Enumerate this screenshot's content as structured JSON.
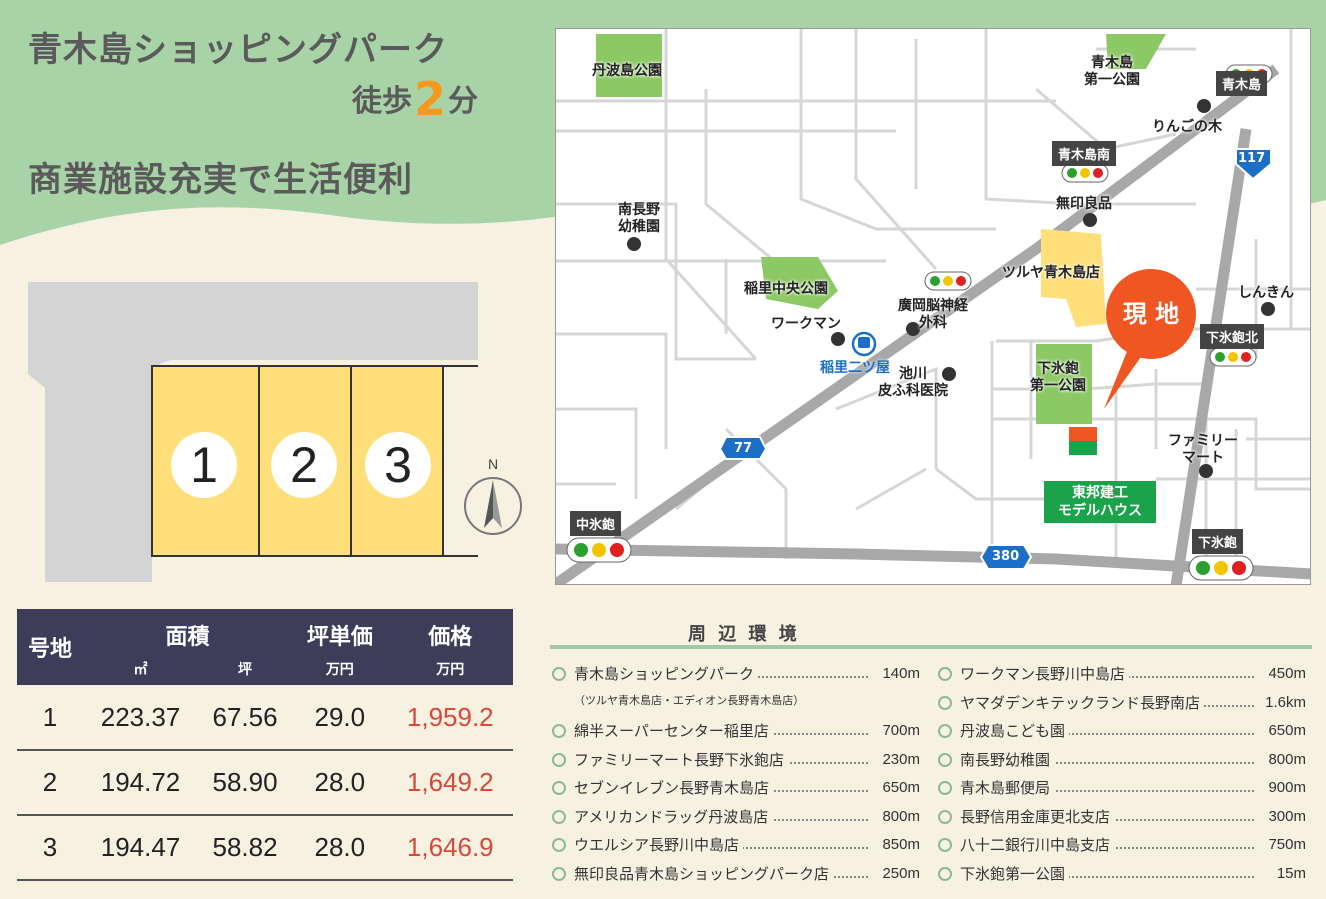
{
  "headline": "青木島ショッピングパーク",
  "walk": {
    "prefix": "徒歩",
    "number": "2",
    "suffix": "分"
  },
  "subline": "商業施設充実で生活便利",
  "lots": [
    "1",
    "2",
    "3"
  ],
  "compass": "N",
  "table": {
    "headers": {
      "lot": "号地",
      "area": "面積",
      "unit_price": "坪単価",
      "price": "価格"
    },
    "units": {
      "sqm": "㎡",
      "tsubo": "坪",
      "unit_price": "万円",
      "price": "万円"
    },
    "rows": [
      {
        "lot": "1",
        "sqm": "223.37",
        "tsubo": "67.56",
        "unit_price": "29.0",
        "price": "1,959.2"
      },
      {
        "lot": "2",
        "sqm": "194.72",
        "tsubo": "58.90",
        "unit_price": "28.0",
        "price": "1,649.2"
      },
      {
        "lot": "3",
        "sqm": "194.47",
        "tsubo": "58.82",
        "unit_price": "28.0",
        "price": "1,646.9"
      }
    ]
  },
  "map": {
    "parks": {
      "tanbajima": "丹波島公園",
      "aokijima_daiichi": "青木島\n第一公園",
      "inasato_chuo": "稲里中央公園",
      "shimohikage": "下氷鉋\n第一公園"
    },
    "places": {
      "ringo": "りんごの木",
      "muji": "無印良品",
      "tsutaya": "ツルヤ青木島店",
      "minaminagano": "南長野\n幼稚園",
      "workman": "ワークマン",
      "clinic": "廣岡脳神経\n外科",
      "derm": "池川\n皮ふ科医院",
      "shinkin": "しんきん",
      "familymart": "ファミリー\nマート"
    },
    "signals": {
      "aokijima": "青木島",
      "aokijima_minami": "青木島南",
      "shimohikage_kita": "下氷鉋北",
      "nakahikage": "中氷鉋",
      "shimohikage": "下氷鉋"
    },
    "station": "稲里二ツ屋",
    "routes": {
      "r117": "117",
      "r77": "77",
      "r380": "380"
    },
    "site": "現 地",
    "model_house": "東邦建工\nモデルハウス"
  },
  "environment": {
    "title": "周 辺 環 境",
    "left": [
      {
        "name": "青木島ショッピングパーク",
        "dist": "140m",
        "note": "（ツルヤ青木島店・エディオン長野青木島店）"
      },
      {
        "name": "綿半スーパーセンター稲里店",
        "dist": "700m"
      },
      {
        "name": "ファミリーマート長野下氷鉋店",
        "dist": "230m"
      },
      {
        "name": "セブンイレブン長野青木島店",
        "dist": "650m"
      },
      {
        "name": "アメリカンドラッグ丹波島店",
        "dist": "800m"
      },
      {
        "name": "ウエルシア長野川中島店",
        "dist": "850m"
      },
      {
        "name": "無印良品青木島ショッピングパーク店",
        "dist": "250m"
      }
    ],
    "right": [
      {
        "name": "ワークマン長野川中島店",
        "dist": "450m"
      },
      {
        "name": "ヤマダデンキテックランド長野南店",
        "dist": "1.6km"
      },
      {
        "name": "丹波島こども園",
        "dist": "650m"
      },
      {
        "name": "南長野幼稚園",
        "dist": "800m"
      },
      {
        "name": "青木島郵便局",
        "dist": "900m"
      },
      {
        "name": "長野信用金庫更北支店",
        "dist": "300m"
      },
      {
        "name": "八十二銀行川中島支店",
        "dist": "750m"
      },
      {
        "name": "下氷鉋第一公園",
        "dist": "15m"
      }
    ]
  },
  "colors": {
    "header_bg": "#3d3c59",
    "price": "#d9493a",
    "lot_fill": "#fedf7a",
    "park": "#8cc864",
    "site": "#ef5621",
    "accent_green": "#a8d3a6"
  }
}
